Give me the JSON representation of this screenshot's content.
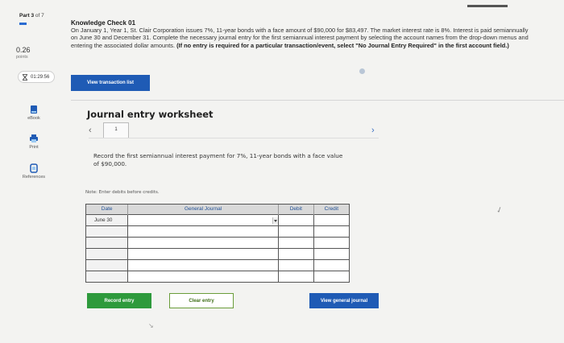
{
  "rail": {
    "part_label": "Part",
    "part_num": "3",
    "part_of": "of 7",
    "points_value": "0.26",
    "points_label": "points",
    "timer": "01:29:56",
    "ebook_label": "eBook",
    "print_label": "Print",
    "references_label": "References"
  },
  "question": {
    "title": "Knowledge Check 01",
    "text": "On January 1, Year 1, St. Clair Corporation issues 7%, 11-year bonds with a face amount of $90,000 for $83,497. The market interest rate is 8%. Interest is paid semiannually on June 30 and December 31. Complete the necessary journal entry for the first semiannual interest payment by selecting the account names from the drop-down menus and entering the associated dollar amounts.",
    "bold_note": "(If no entry is required for a particular transaction/event, select \"No Journal Entry Required\" in the first account field.)"
  },
  "buttons": {
    "view_transaction_list": "View transaction list",
    "record_entry": "Record entry",
    "clear_entry": "Clear entry",
    "view_general_journal": "View general journal"
  },
  "worksheet": {
    "title": "Journal entry worksheet",
    "tab": "1",
    "instruction": "Record the first semiannual interest payment for 7%, 11-year bonds with a face value of $90,000.",
    "note": "Note: Enter debits before credits."
  },
  "journal": {
    "headers": [
      "Date",
      "General Journal",
      "Debit",
      "Credit"
    ],
    "rows": [
      [
        "June 30",
        "",
        "",
        ""
      ],
      [
        "",
        "",
        "",
        ""
      ],
      [
        "",
        "",
        "",
        ""
      ],
      [
        "",
        "",
        "",
        ""
      ],
      [
        "",
        "",
        "",
        ""
      ],
      [
        "",
        "",
        "",
        ""
      ]
    ]
  },
  "colors": {
    "accent_blue": "#1f5bb5",
    "record_green": "#2e9a3c"
  }
}
